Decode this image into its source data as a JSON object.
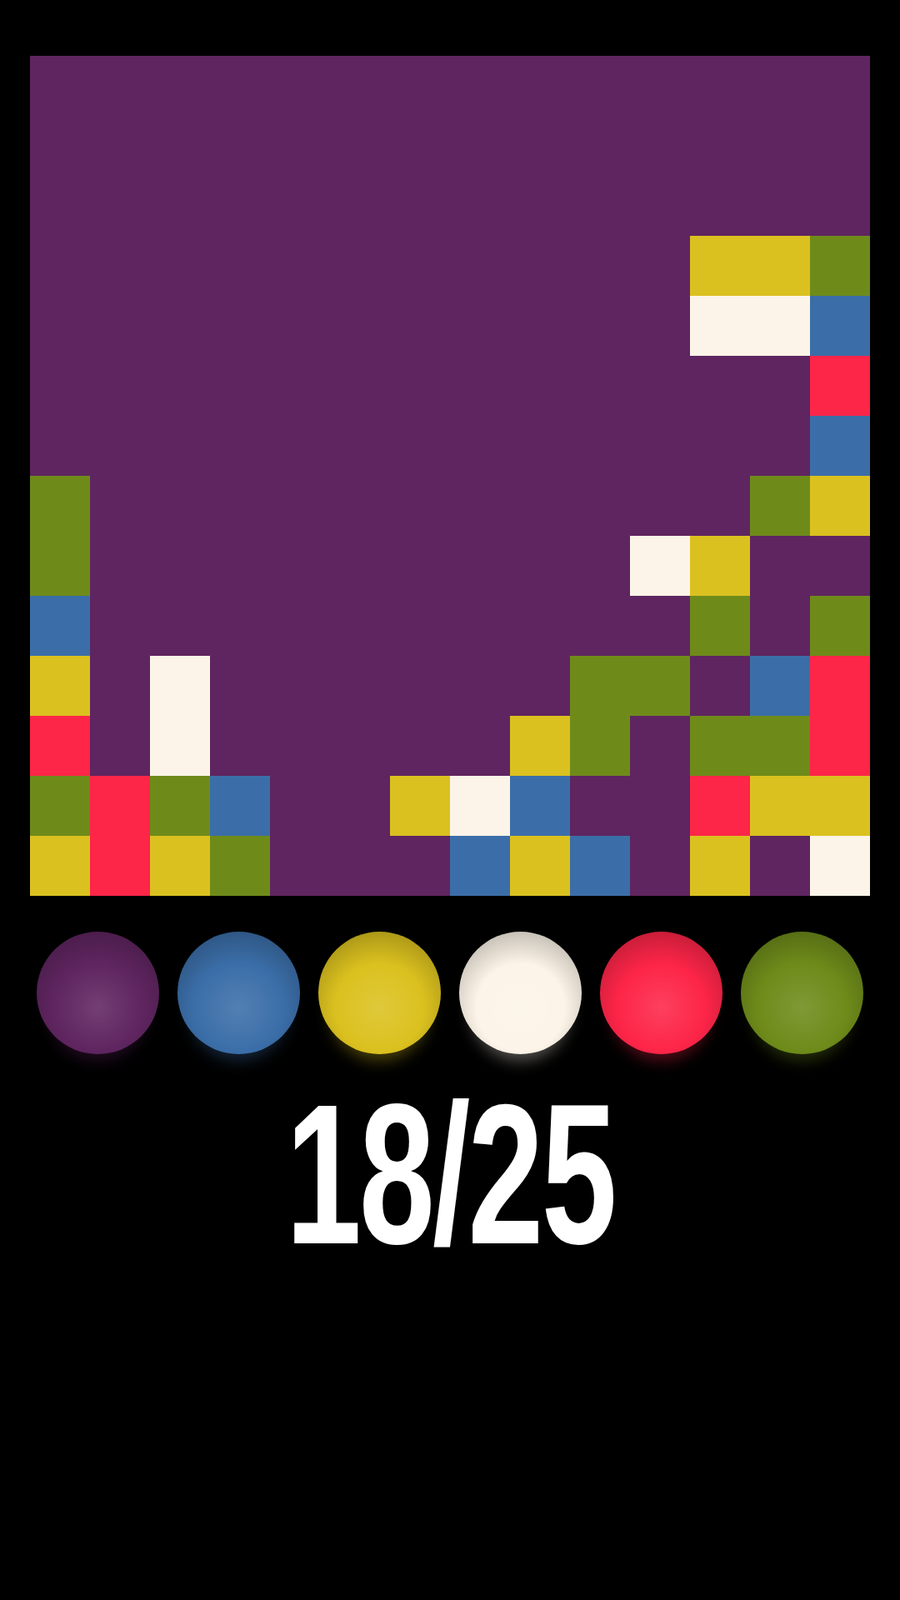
{
  "board": {
    "rows": [
      "PPPPPPPPPPPPPP",
      "PPPPPPPPPPPPPP",
      "PPPPPPPPPPPPPP",
      "PPPPPPPPPPPYYG",
      "PPPPPPPPPPPWWB",
      "PPPPPPPPPPPPPR",
      "PPPPPPPPPPPPPB",
      "GPPPPPPPPPPPGY",
      "GPPPPPPPPPWYPP",
      "BPPPPPPPPPPGPG",
      "YPWPPPPPPGGPBR",
      "RPWPPPPPYGPGGR",
      "GRGBPPYWBPPRYY",
      "YRYGPPPBYBPYPW"
    ]
  },
  "palette": [
    {
      "key": "P",
      "color": "#5f2560"
    },
    {
      "key": "B",
      "color": "#3b6ea8"
    },
    {
      "key": "Y",
      "color": "#dbc11f"
    },
    {
      "key": "W",
      "color": "#fcf4e8"
    },
    {
      "key": "R",
      "color": "#fd2548"
    },
    {
      "key": "G",
      "color": "#6e8b1a"
    }
  ],
  "counter": "18/25"
}
